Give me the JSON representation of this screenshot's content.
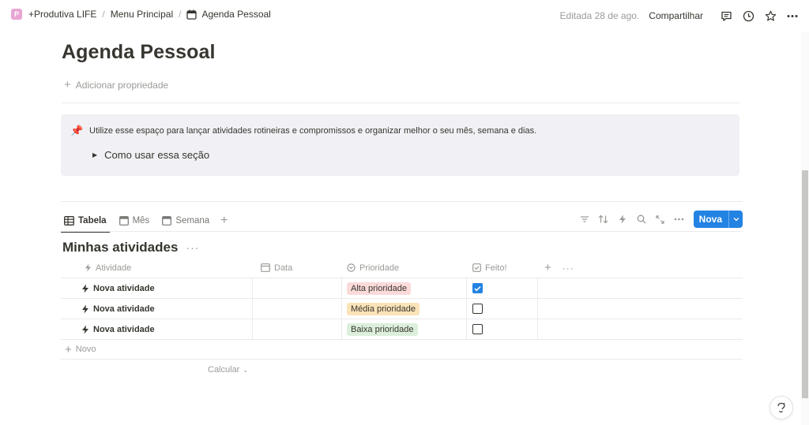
{
  "breadcrumb": {
    "workspace": "+Produtiva LIFE",
    "menu": "Menu Principal",
    "page": "Agenda Pessoal",
    "separator": "/"
  },
  "topbar": {
    "edited": "Editada 28 de ago.",
    "share": "Compartilhar",
    "icons": [
      "comment-icon",
      "clock-icon",
      "star-icon",
      "more-icon"
    ]
  },
  "page": {
    "title": "Agenda Pessoal",
    "add_property": "Adicionar propriedade"
  },
  "callout": {
    "icon": "pin-icon",
    "text": "Utilize esse espaço para lançar atividades rotineiras e compromissos e organizar melhor o seu mês, semana e dias.",
    "toggle_label": "Como usar essa seção",
    "background": "#f1f0f4"
  },
  "views": {
    "tabs": [
      {
        "label": "Tabela",
        "active": true
      },
      {
        "label": "Mês",
        "active": false
      },
      {
        "label": "Semana",
        "active": false
      }
    ],
    "new_button": "Nova",
    "accent": "#2383e2"
  },
  "database": {
    "title": "Minhas atividades",
    "columns": [
      {
        "label": "Atividade",
        "icon": "lightning-icon"
      },
      {
        "label": "Data",
        "icon": "calendar-icon"
      },
      {
        "label": "Prioridade",
        "icon": "status-icon"
      },
      {
        "label": "Feito!",
        "icon": "checkbox-icon"
      }
    ],
    "rows": [
      {
        "name": "Nova atividade",
        "date": "",
        "priority": "Alta prioridade",
        "priority_color": "red",
        "done": true
      },
      {
        "name": "Nova atividade",
        "date": "",
        "priority": "Média prioridade",
        "priority_color": "yellow",
        "done": false
      },
      {
        "name": "Nova atividade",
        "date": "",
        "priority": "Baixa prioridade",
        "priority_color": "green",
        "done": false
      }
    ],
    "new_row": "Novo",
    "calculate": "Calcular"
  }
}
